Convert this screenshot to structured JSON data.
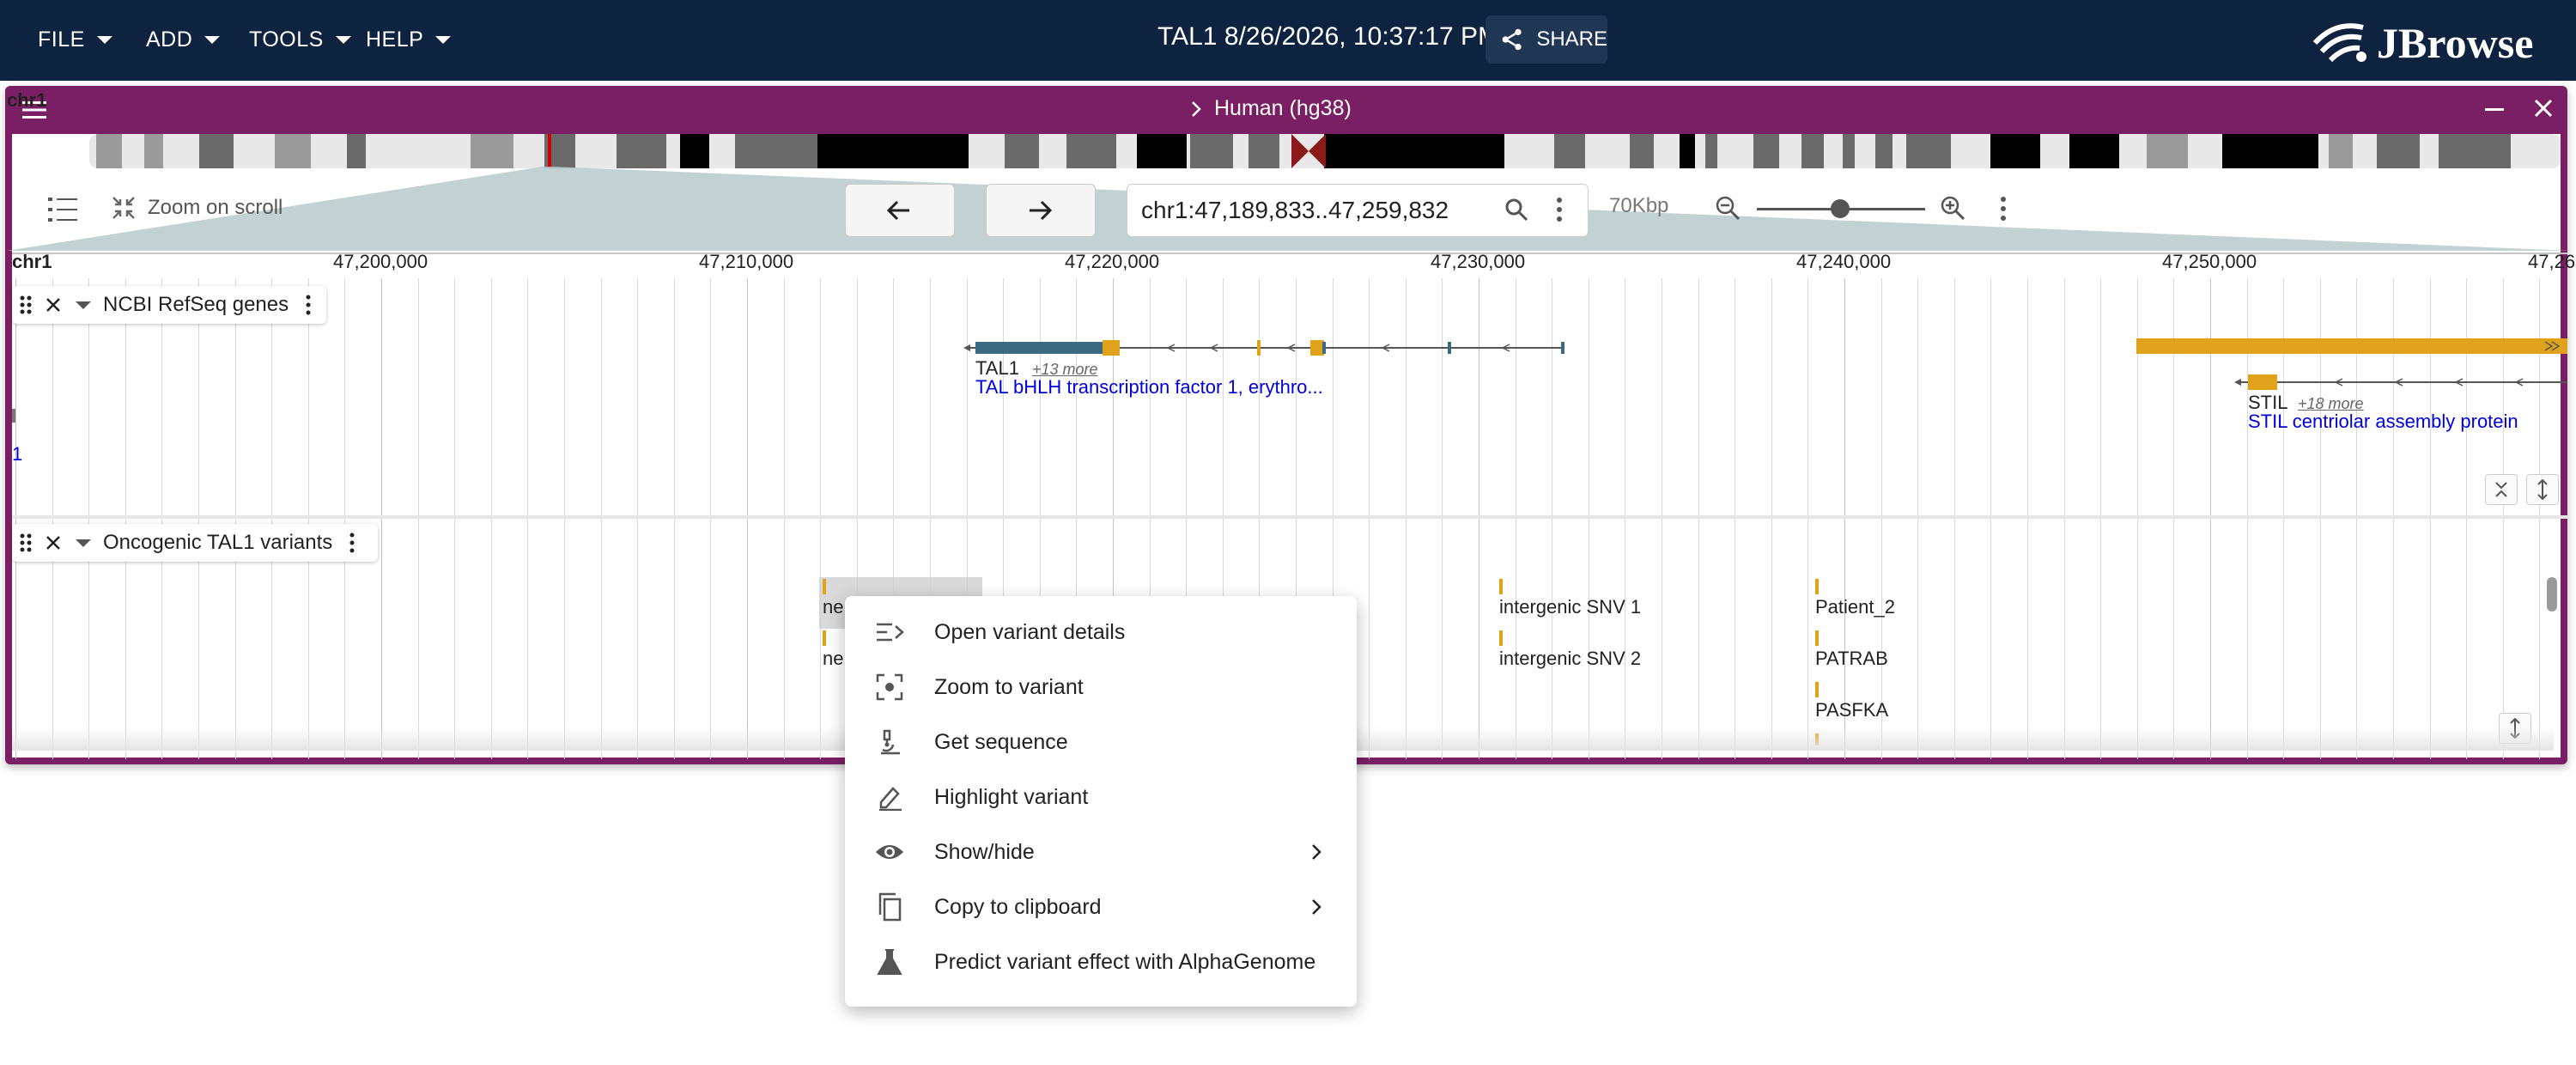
{
  "app": {
    "menus": [
      "FILE",
      "ADD",
      "TOOLS",
      "HELP"
    ],
    "session_title": "TAL1 8/26/2026, 10:37:17 PM",
    "share_label": "SHARE",
    "logo_text": "JBrowse",
    "brand_color": "#0d233f",
    "view_color": "#7a1f63"
  },
  "view": {
    "assembly_title": "Human (hg38)",
    "chrom": "chr1",
    "locstring": "chr1:47,189,833..47,259,832",
    "span": "70Kbp",
    "zoom_on_scroll": "Zoom on scroll",
    "zoom_level": 0.55,
    "ruler_ticks": [
      "47,200,000",
      "47,210,000",
      "47,220,000",
      "47,230,000",
      "47,240,000",
      "47,250,000",
      "47,26"
    ]
  },
  "tracks": {
    "genes": {
      "name": "NCBI RefSeq genes",
      "left_edge_label": "1",
      "features": [
        {
          "name": "TAL1",
          "more": "+13 more",
          "desc": "TAL bHLH transcription factor 1, erythro..."
        },
        {
          "name": "STIL",
          "more": "+18 more",
          "desc": "STIL centriolar assembly protein"
        }
      ]
    },
    "variants": {
      "name": "Oncogenic TAL1 variants",
      "labels": [
        "ne",
        "ne",
        "intergenic SNV 1",
        "intergenic SNV 2",
        "Patient_2",
        "PATRAB",
        "PASFKA"
      ]
    }
  },
  "context_menu": {
    "items": [
      {
        "label": "Open variant details",
        "icon": "list-details-icon"
      },
      {
        "label": "Zoom to variant",
        "icon": "center-focus-icon"
      },
      {
        "label": "Get sequence",
        "icon": "microscope-icon"
      },
      {
        "label": "Highlight variant",
        "icon": "highlighter-icon"
      },
      {
        "label": "Show/hide",
        "icon": "eye-icon"
      },
      {
        "label": "Copy to clipboard",
        "icon": "copy-icon"
      },
      {
        "label": "Predict variant effect with AlphaGenome",
        "icon": "flask-icon"
      }
    ]
  }
}
